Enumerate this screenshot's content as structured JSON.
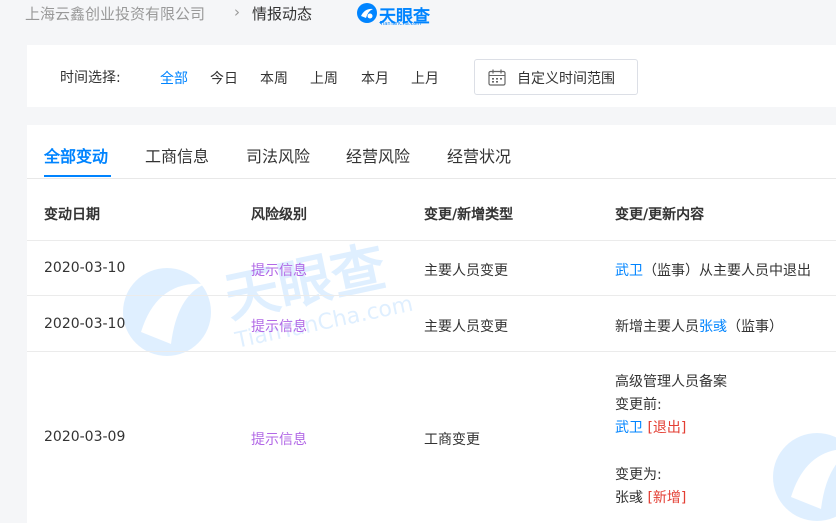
{
  "breadcrumb": {
    "company": "上海云鑫创业投资有限公司",
    "separator": "›",
    "page": "情报动态"
  },
  "brand": {
    "name": "天眼查",
    "sub": "TianYanCha.com",
    "color": "#0084ff"
  },
  "filter": {
    "label": "时间选择:",
    "options": [
      "全部",
      "今日",
      "本周",
      "上周",
      "本月",
      "上月"
    ],
    "active_index": 0,
    "custom_range_label": "自定义时间范围"
  },
  "tabs": [
    {
      "label": "全部变动",
      "active": true
    },
    {
      "label": "工商信息",
      "active": false
    },
    {
      "label": "司法风险",
      "active": false
    },
    {
      "label": "经营风险",
      "active": false
    },
    {
      "label": "经营状况",
      "active": false
    }
  ],
  "table": {
    "headers": [
      "变动日期",
      "风险级别",
      "变更/新增类型",
      "变更/更新内容"
    ],
    "rows": [
      {
        "date": "2020-03-10",
        "risk": "提示信息",
        "type": "主要人员变更",
        "content": {
          "person": "武卫",
          "text": "（监事）从主要人员中退出"
        }
      },
      {
        "date": "2020-03-10",
        "risk": "提示信息",
        "type": "主要人员变更",
        "content": {
          "prefix": "新增主要人员",
          "person": "张彧",
          "suffix": "（监事）"
        }
      },
      {
        "date": "2020-03-09",
        "risk": "提示信息",
        "type": "工商变更",
        "content": {
          "title": "高级管理人员备案",
          "before_label": "变更前:",
          "before_person": "武卫",
          "before_tag": "[退出]",
          "after_label": "变更为:",
          "after_person": "张彧",
          "after_tag": "[新增]"
        }
      }
    ]
  },
  "colors": {
    "accent": "#0084ff",
    "risk_info": "#b268e6",
    "tag_red": "#e33e33"
  }
}
